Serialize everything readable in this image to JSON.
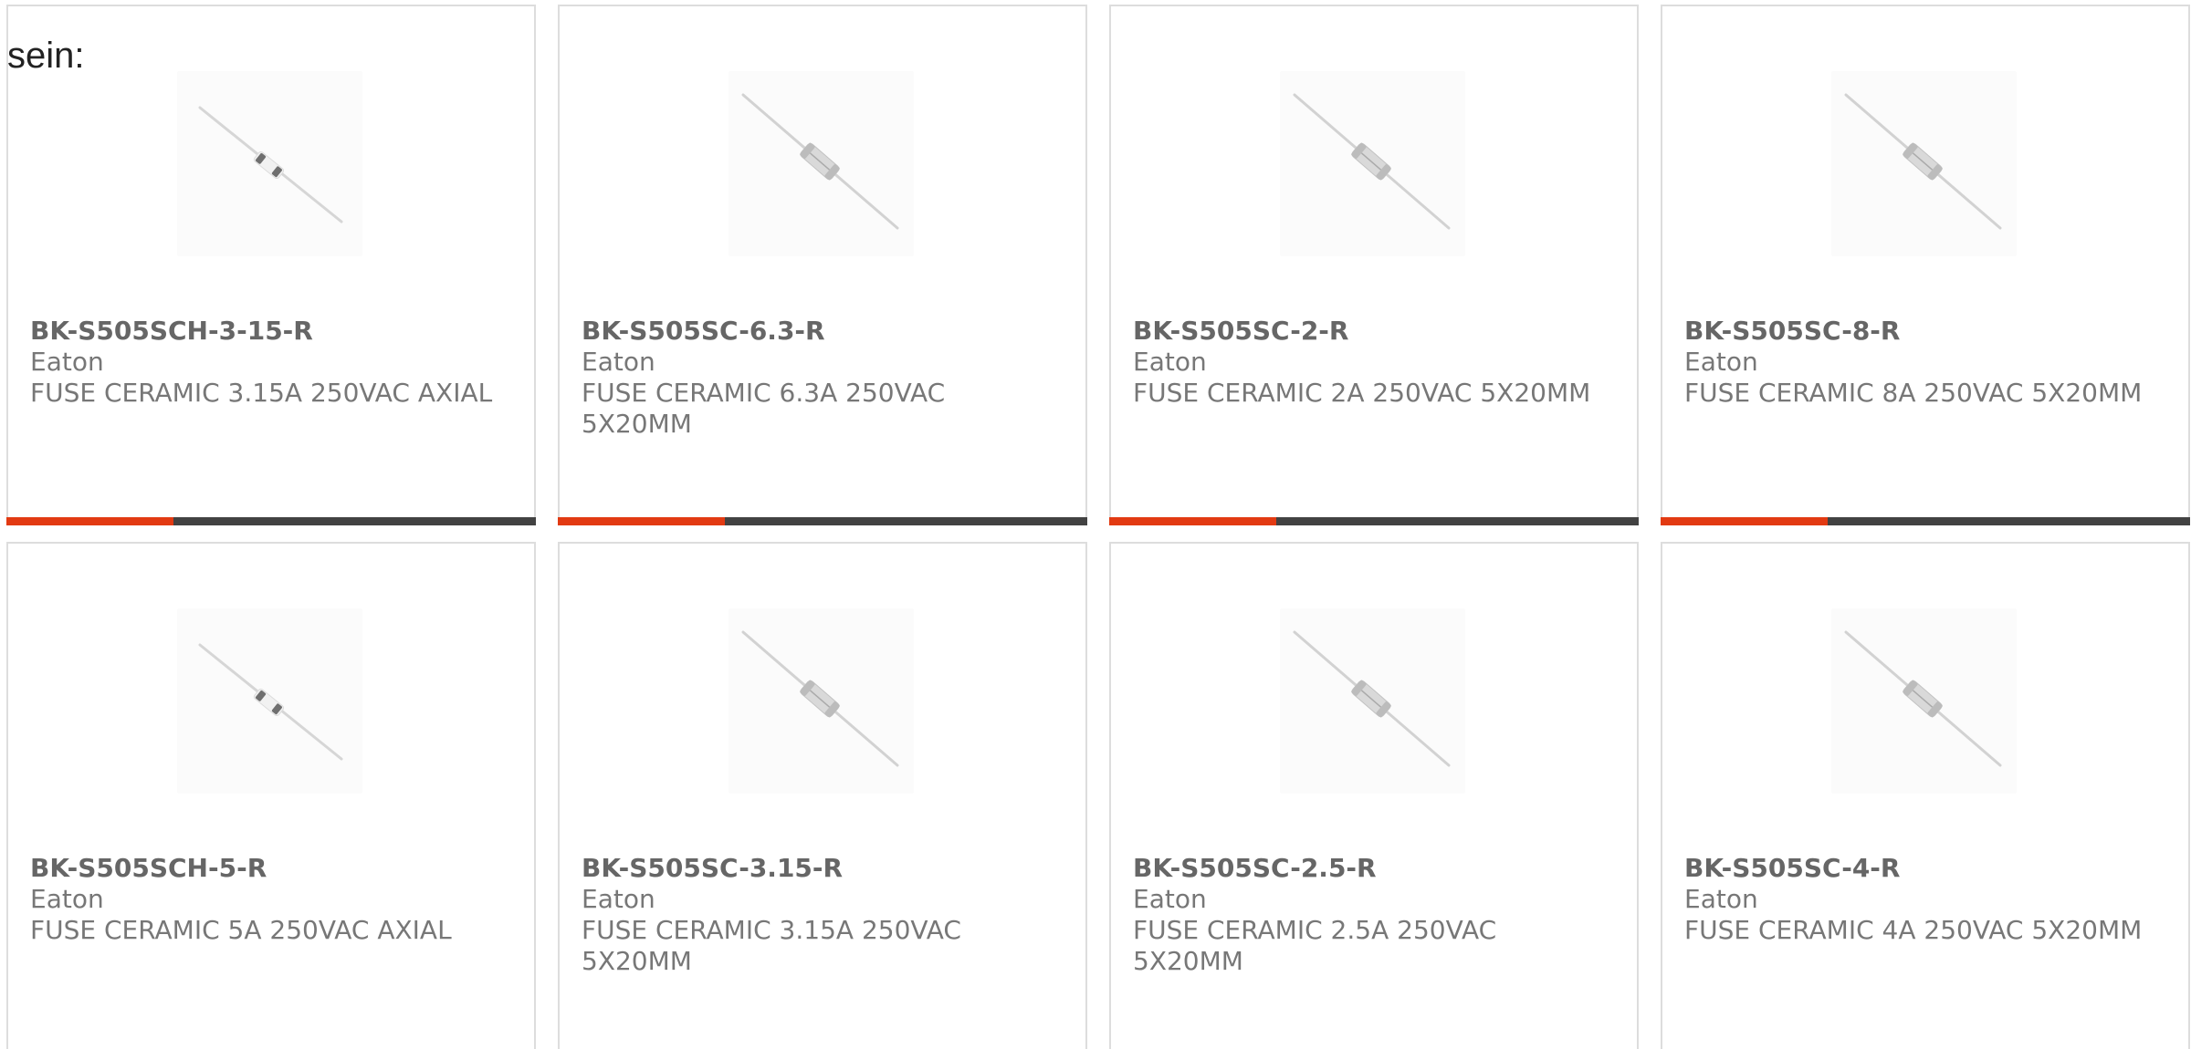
{
  "intro_text": "sein:",
  "colors": {
    "accent": "#e23a12",
    "bar": "#424242",
    "card_border": "#dddddd",
    "text": "#777777"
  },
  "products": [
    {
      "part_number": "BK-S505SCH-3-15-R",
      "manufacturer": "Eaton",
      "description": "FUSE CERAMIC 3.15A 250VAC AXIAL",
      "image_icon": "axial-fuse-glass-icon"
    },
    {
      "part_number": "BK-S505SC-6.3-R",
      "manufacturer": "Eaton",
      "description": "FUSE CERAMIC 6.3A 250VAC 5X20MM",
      "image_icon": "ceramic-fuse-icon"
    },
    {
      "part_number": "BK-S505SC-2-R",
      "manufacturer": "Eaton",
      "description": "FUSE CERAMIC 2A 250VAC 5X20MM",
      "image_icon": "ceramic-fuse-icon"
    },
    {
      "part_number": "BK-S505SC-8-R",
      "manufacturer": "Eaton",
      "description": "FUSE CERAMIC 8A 250VAC 5X20MM",
      "image_icon": "ceramic-fuse-icon"
    },
    {
      "part_number": "BK-S505SCH-5-R",
      "manufacturer": "Eaton",
      "description": "FUSE CERAMIC 5A 250VAC AXIAL",
      "image_icon": "axial-fuse-glass-icon"
    },
    {
      "part_number": "BK-S505SC-3.15-R",
      "manufacturer": "Eaton",
      "description": "FUSE CERAMIC 3.15A 250VAC 5X20MM",
      "image_icon": "ceramic-fuse-icon"
    },
    {
      "part_number": "BK-S505SC-2.5-R",
      "manufacturer": "Eaton",
      "description": "FUSE CERAMIC 2.5A 250VAC 5X20MM",
      "image_icon": "ceramic-fuse-icon"
    },
    {
      "part_number": "BK-S505SC-4-R",
      "manufacturer": "Eaton",
      "description": "FUSE CERAMIC 4A 250VAC 5X20MM",
      "image_icon": "ceramic-fuse-icon"
    }
  ]
}
